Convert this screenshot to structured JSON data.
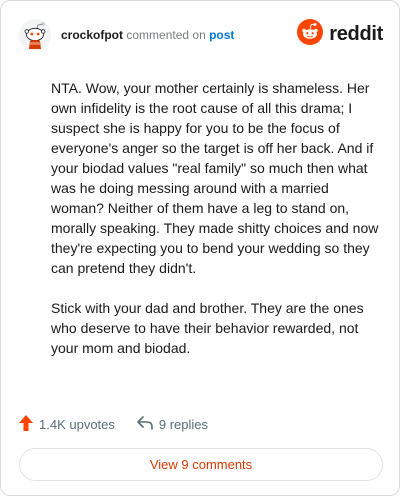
{
  "comment": {
    "username": "crockofpot",
    "action_text": "commented on",
    "post_link_label": "post",
    "paragraphs": [
      "NTA. Wow, your mother certainly is shameless. Her own infidelity is the root cause of all this drama; I suspect she is happy for you to be the focus of everyone's anger so the target is off her back. And if your biodad values \"real family\" so much then what was he doing messing around with a married woman? Neither of them have a leg to stand on, morally speaking. They made shitty choices and now they're expecting you to bend your wedding so they can pretend they didn't.",
      "Stick with your dad and brother. They are the ones who deserve to have their behavior rewarded, not your mom and biodad."
    ]
  },
  "brand": {
    "logo_text": "reddit",
    "color": "#ff4500"
  },
  "stats": {
    "upvotes_label": "1.4K upvotes",
    "replies_label": "9 replies"
  },
  "view_comments_label": "View 9 comments",
  "icons": {
    "avatar": "snoo-avatar-icon",
    "logo": "reddit-snoo-icon",
    "upvote": "upvote-arrow-icon",
    "reply": "reply-arrow-icon"
  },
  "colors": {
    "upvote": "#ff4500",
    "link": "#0079d3",
    "view_button_text": "#d93a00"
  }
}
